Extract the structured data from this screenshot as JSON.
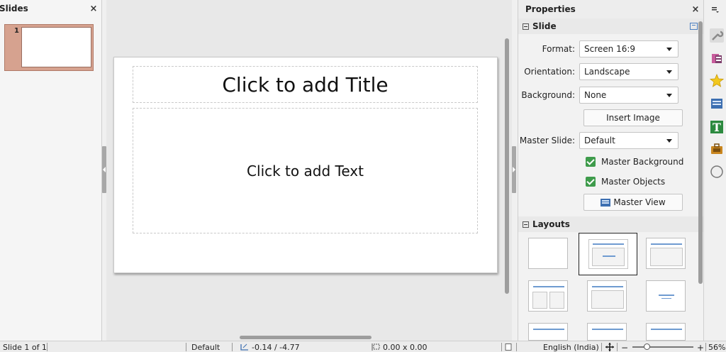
{
  "slides_pane": {
    "title": "Slides",
    "close": "×",
    "slide_number": "1"
  },
  "slide": {
    "title_placeholder": "Click to add Title",
    "text_placeholder": "Click to add Text"
  },
  "properties": {
    "title": "Properties",
    "close": "×",
    "slide_section": "Slide",
    "format_label": "Format:",
    "format_value": "Screen 16:9",
    "orientation_label": "Orientation:",
    "orientation_value": "Landscape",
    "background_label": "Background:",
    "background_value": "None",
    "insert_image": "Insert Image",
    "master_slide_label": "Master Slide:",
    "master_slide_value": "Default",
    "master_background": "Master Background",
    "master_objects": "Master Objects",
    "master_view": "Master View",
    "layouts_section": "Layouts"
  },
  "sidebar_tabs": [
    "wrench-icon",
    "slide-transition-icon",
    "animation-icon",
    "master-slides-icon",
    "styles-icon",
    "gallery-icon",
    "navigator-icon"
  ],
  "statusbar": {
    "slide_position": "Slide 1 of 1",
    "master": "Default",
    "position": "-0.14 / -4.77",
    "size": "0.00 x 0.00",
    "language": "English (India)",
    "zoom_minus": "−",
    "zoom_plus": "+",
    "zoom_value": "56%"
  }
}
